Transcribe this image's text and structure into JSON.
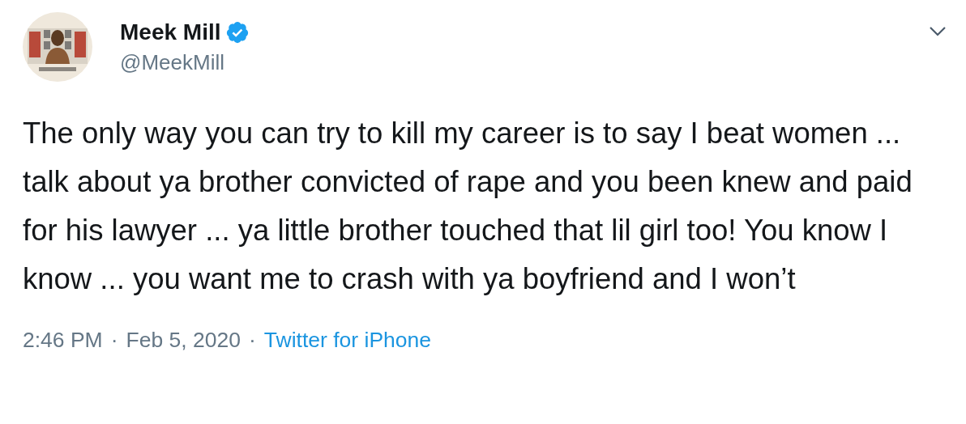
{
  "tweet": {
    "author": {
      "name": "Meek Mill",
      "verified": true,
      "handle": "@MeekMill"
    },
    "text": "The only way you can try to kill my career is to say I beat women ... talk about ya brother convicted of rape and you been knew and paid for his lawyer ... ya little brother touched that lil girl too! You know I know ... you want me to crash with ya boyfriend and I won’t",
    "time": "2:46 PM",
    "separator_1": "·",
    "date": "Feb 5, 2020",
    "separator_2": "·",
    "source": "Twitter for iPhone"
  }
}
